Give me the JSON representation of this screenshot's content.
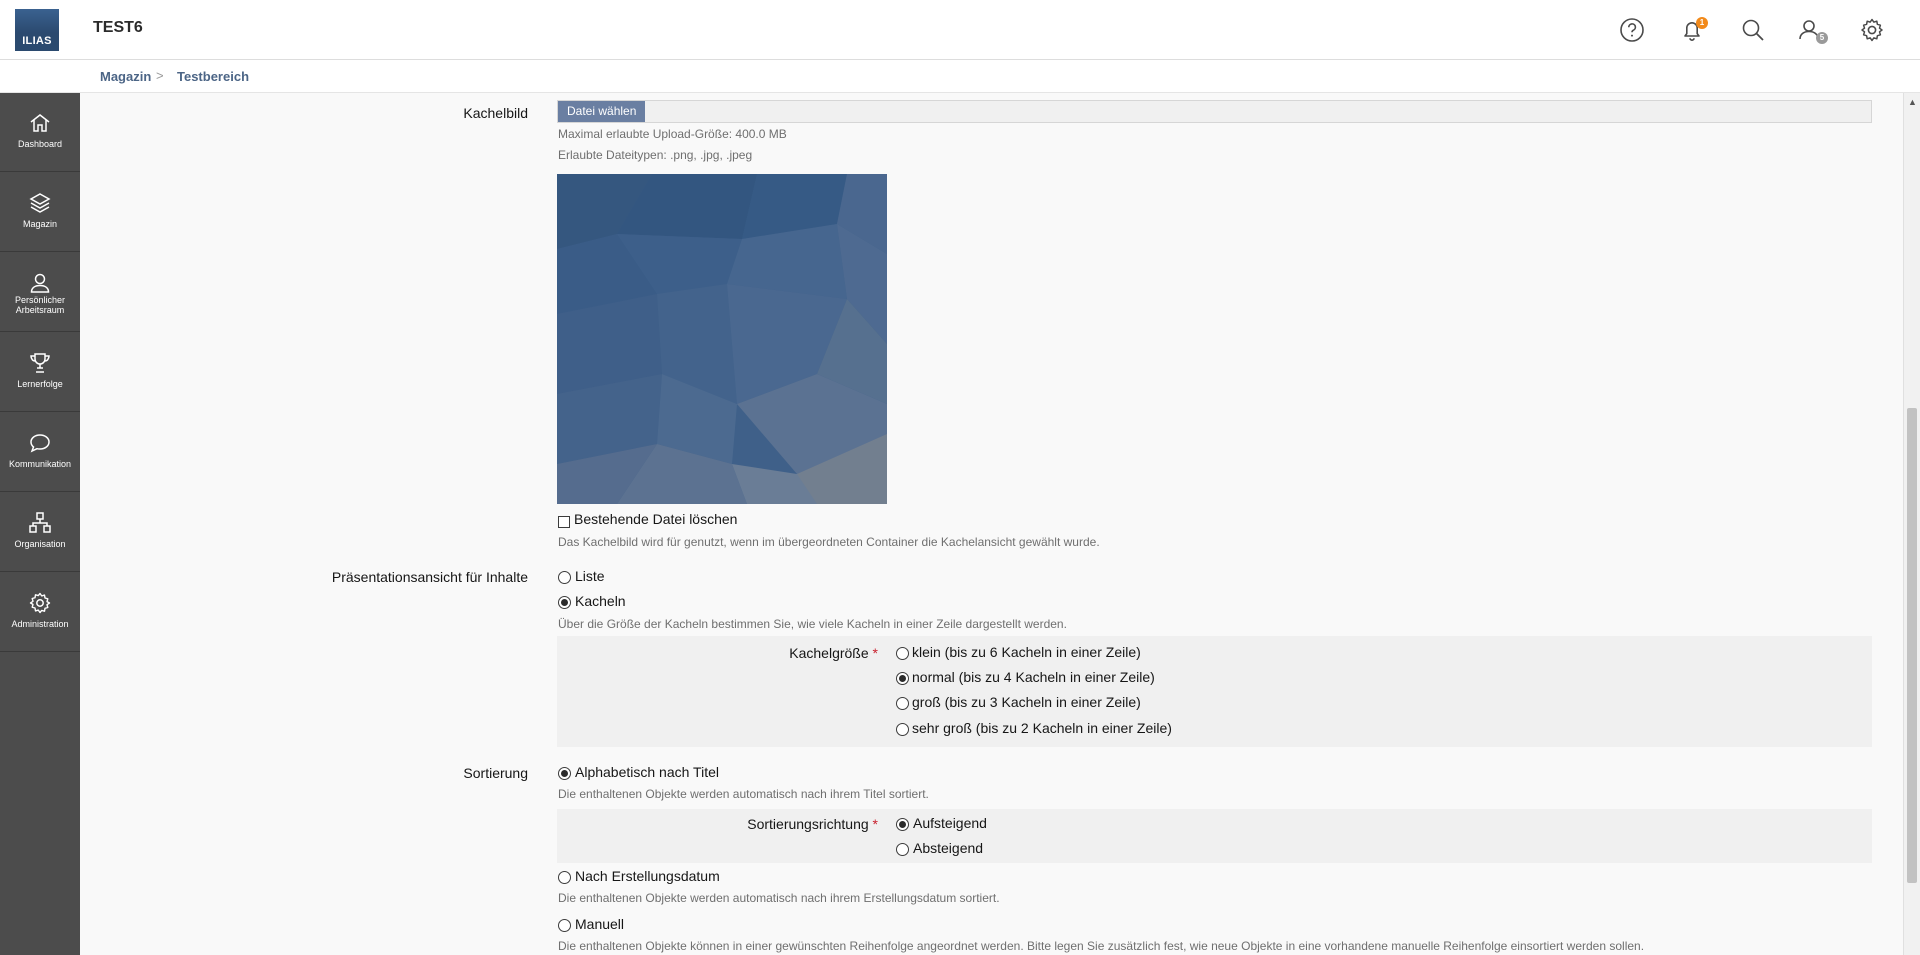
{
  "header": {
    "logo_text": "ILIAS",
    "title": "TEST6",
    "notification_count": "1",
    "contacts_count": "5",
    "icons": [
      "help-icon",
      "bell-icon",
      "search-icon",
      "contacts-icon",
      "settings-icon"
    ]
  },
  "breadcrumb": [
    {
      "label": "Magazin"
    },
    {
      "label": "Testbereich"
    }
  ],
  "sidebar": {
    "items": [
      {
        "label": "Dashboard",
        "icon": "home-icon"
      },
      {
        "label": "Magazin",
        "icon": "layers-icon"
      },
      {
        "label": "Persönlicher Arbeitsraum",
        "icon": "user-icon"
      },
      {
        "label": "Lernerfolge",
        "icon": "trophy-icon"
      },
      {
        "label": "Kommunikation",
        "icon": "chat-icon"
      },
      {
        "label": "Organisation",
        "icon": "org-icon"
      },
      {
        "label": "Administration",
        "icon": "gear-icon"
      }
    ]
  },
  "form": {
    "kachelbild": {
      "label": "Kachelbild",
      "button": "Datei wählen",
      "max_size": "Maximal erlaubte Upload-Größe: 400.0 MB",
      "file_types": "Erlaubte Dateitypen: .png, .jpg, .jpeg",
      "delete_label": "Bestehende Datei löschen",
      "delete_checked": false,
      "help": "Das Kachelbild wird für genutzt, wenn im übergeordneten Container die Kachelansicht gewählt wurde."
    },
    "presentation": {
      "label": "Präsentationsansicht für Inhalte",
      "options": [
        {
          "label": "Liste",
          "checked": false
        },
        {
          "label": "Kacheln",
          "checked": true
        }
      ],
      "help": "Über die Größe der Kacheln bestimmen Sie, wie viele Kacheln in einer Zeile dargestellt werden.",
      "tile_size": {
        "label": "Kachelgröße",
        "required_mark": "*",
        "options": [
          {
            "label": "klein (bis zu 6 Kacheln in einer Zeile)",
            "checked": false
          },
          {
            "label": "normal (bis zu 4 Kacheln in einer Zeile)",
            "checked": true
          },
          {
            "label": "groß (bis zu 3 Kacheln in einer Zeile)",
            "checked": false
          },
          {
            "label": "sehr groß (bis zu 2 Kacheln in einer Zeile)",
            "checked": false
          }
        ]
      }
    },
    "sorting": {
      "label": "Sortierung",
      "options": [
        {
          "label": "Alphabetisch nach Titel",
          "checked": true,
          "help": "Die enthaltenen Objekte werden automatisch nach ihrem Titel sortiert."
        },
        {
          "label": "Nach Erstellungsdatum",
          "checked": false,
          "help": "Die enthaltenen Objekte werden automatisch nach ihrem Erstellungsdatum sortiert."
        },
        {
          "label": "Manuell",
          "checked": false,
          "help": "Die enthaltenen Objekte können in einer gewünschten Reihenfolge angeordnet werden. Bitte legen Sie zusätzlich fest, wie neue Objekte in eine vorhandene manuelle Reihenfolge einsortiert werden sollen."
        }
      ],
      "direction": {
        "label": "Sortierungsrichtung",
        "required_mark": "*",
        "options": [
          {
            "label": "Aufsteigend",
            "checked": true
          },
          {
            "label": "Absteigend",
            "checked": false
          }
        ]
      }
    }
  },
  "colors": {
    "accent": "#4c6586",
    "sidebar_bg": "#4c4c4c",
    "button_bg": "#6a7fa2",
    "badge_orange": "#f28a1b",
    "required": "#c8202d"
  }
}
